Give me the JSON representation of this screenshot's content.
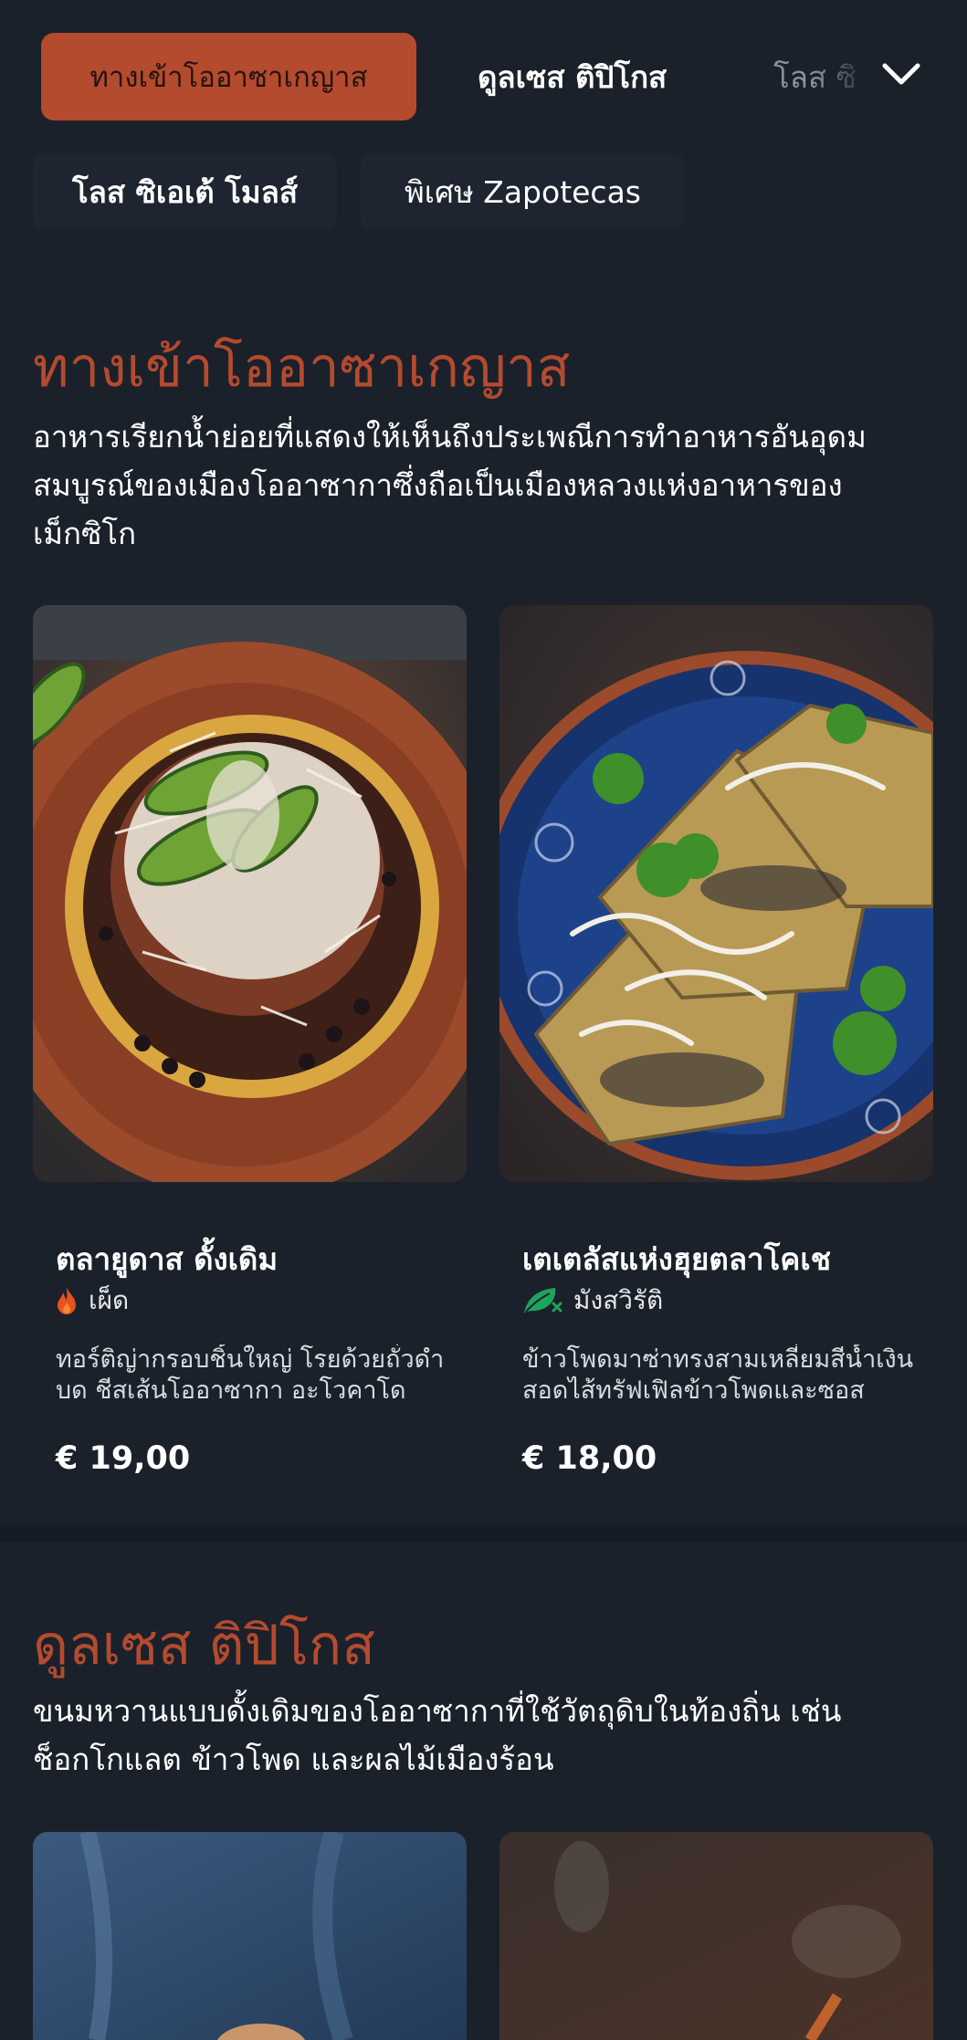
{
  "nav": {
    "tabs": [
      {
        "label": "ทางเข้าโออาซาเกญาส"
      },
      {
        "label": "ดูลเซส ติปิโกส"
      },
      {
        "label": "โลส ซิ"
      }
    ],
    "chips": [
      {
        "label": "โลส ซิเอเต้ โมลส์"
      },
      {
        "label": "พิเศษ Zapotecas"
      }
    ],
    "expand_icon": "chevron-down-icon"
  },
  "sections": [
    {
      "title": "ทางเข้าโออาซาเกญาส",
      "description": "อาหารเรียกน้ำย่อยที่แสดงให้เห็นถึงประเพณีการทำอาหารอันอุดมสมบูรณ์ของเมืองโออาซากาซึ่งถือเป็นเมืองหลวงแห่งอาหารของเม็กซิโก",
      "items": [
        {
          "name": "ตลายูดาส ดั้งเดิม",
          "tag": "เผ็ด",
          "tag_icon": "flame-icon",
          "tag_color": "#e8521e",
          "description": "ทอร์ติญ่ากรอบชิ้นใหญ่ โรยด้วยถั่วดำบด ชีสเส้นโออาซากา อะโวคาโด",
          "price": "€ 19,00"
        },
        {
          "name": "เตเตลัสแห่งฮุยตลาโคเช",
          "tag": "มังสวิรัติ",
          "tag_icon": "vegan-leaf-icon",
          "tag_color": "#1fa35c",
          "description": "ข้าวโพดมาซ่าทรงสามเหลี่ยมสีน้ำเงินสอดไส้ทรัฟเฟิลข้าวโพดและซอส",
          "price": "€ 18,00"
        }
      ]
    },
    {
      "title": "ดูลเซส ติปิโกส",
      "description": "ขนมหวานแบบดั้งเดิมของโออาซากาที่ใช้วัตถุดิบในท้องถิ่น เช่น ช็อกโกแลต ข้าวโพด และผลไม้เมืองร้อน"
    }
  ],
  "colors": {
    "background": "#1a212b",
    "accent": "#b44a2e",
    "text": "#ffffff"
  }
}
